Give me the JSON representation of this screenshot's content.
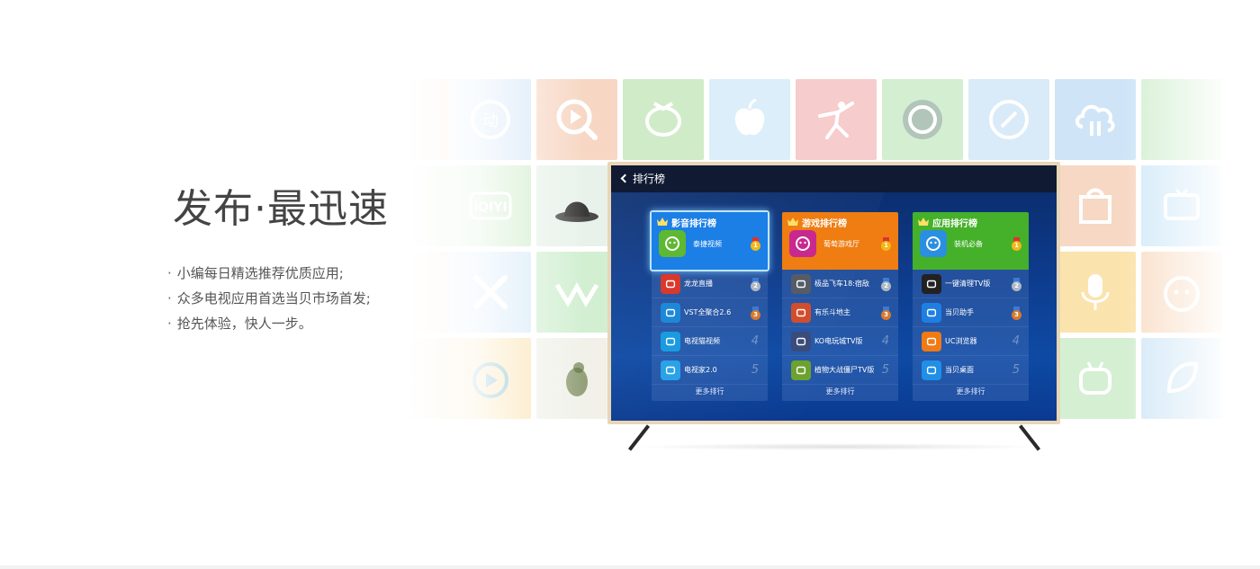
{
  "hero": {
    "title": "发布·最迅速",
    "bullets": [
      "小编每日精选推荐优质应用;",
      "众多电视应用首选当贝市场首发;",
      "抢先体验，快人一步。"
    ],
    "bullet_mark": "·"
  },
  "tv": {
    "back_label": "排行榜",
    "columns": [
      {
        "title": "影音排行榜",
        "color": "#1b7fe6",
        "top": {
          "name": "泰捷视频",
          "rank": "1",
          "icon": "robot-icon",
          "color": "#5fb831"
        },
        "rows": [
          {
            "name": "龙龙直播",
            "rank": "2",
            "icon": "longlong-logo-icon",
            "color": "#d9392b"
          },
          {
            "name": "VST全聚合2.6",
            "rank": "3",
            "icon": "vst-logo-icon",
            "color": "#1e88d8"
          },
          {
            "name": "电视猫视频",
            "rank": "4",
            "icon": "play-cat-icon",
            "color": "#1a9be0"
          },
          {
            "name": "电视家2.0",
            "rank": "5",
            "icon": "tv-icon",
            "color": "#2aa2e8"
          }
        ],
        "more": "更多排行"
      },
      {
        "title": "游戏排行榜",
        "color": "#ef7d11",
        "top": {
          "name": "葡萄游戏厅",
          "rank": "1",
          "icon": "grape-game-icon",
          "color": "#c9288f"
        },
        "rows": [
          {
            "name": "极品飞车18:宿敌",
            "rank": "2",
            "icon": "race-car-icon",
            "color": "#555c66"
          },
          {
            "name": "有乐斗地主",
            "rank": "3",
            "icon": "card-game-icon",
            "color": "#d24d2c"
          },
          {
            "name": "KO电玩城TV版",
            "rank": "4",
            "icon": "ko-star-icon",
            "color": "#3b4b7a"
          },
          {
            "name": "植物大战僵尸TV版",
            "rank": "5",
            "icon": "zombie-icon",
            "color": "#6da130"
          }
        ],
        "more": "更多排行"
      },
      {
        "title": "应用排行榜",
        "color": "#45b02a",
        "top": {
          "name": "装机必备",
          "rank": "1",
          "icon": "tools-icon",
          "color": "#2a8fe0"
        },
        "rows": [
          {
            "name": "一键清理TV版",
            "rank": "2",
            "icon": "cleaner-icon",
            "color": "#222222"
          },
          {
            "name": "当贝助手",
            "rank": "3",
            "icon": "assistant-icon",
            "color": "#1f7fe0"
          },
          {
            "name": "UC浏览器",
            "rank": "4",
            "icon": "uc-browser-icon",
            "color": "#f07a14"
          },
          {
            "name": "当贝桌面",
            "rank": "5",
            "icon": "home-desktop-icon",
            "color": "#1f8fe8"
          }
        ],
        "more": "更多排行"
      }
    ]
  },
  "medal_colors": {
    "gold": "#f2b718",
    "silver": "#aeb8c4",
    "bronze": "#d9792c"
  },
  "tile_colors": [
    "#f6c7a0",
    "#cfe3f5",
    "#f7d8c4",
    "#cdebc6",
    "#d8ecf8",
    "#f6c9c9",
    "#d4edd1",
    "#d6e9f8",
    "#cde4f6",
    "#d2efd1"
  ]
}
